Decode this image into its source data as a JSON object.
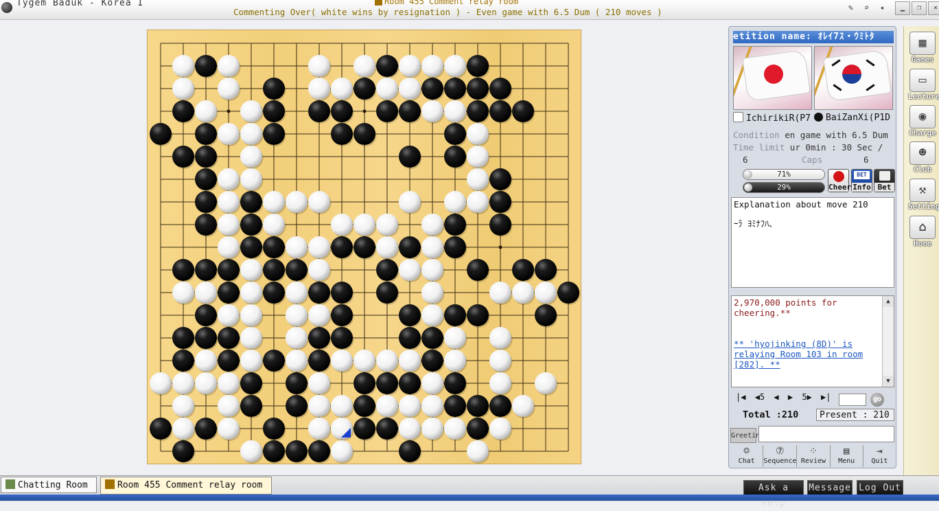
{
  "window": {
    "app_title": "Tygem Baduk - Korea I",
    "room_title": "Room 455 Comment relay room",
    "status_line": "Commenting Over( white wins by resignation ) - Even game with 6.5 Dum  ( 210 moves )"
  },
  "board": {
    "size": 19,
    "black": [
      [
        2,
        1
      ],
      [
        10,
        1
      ],
      [
        14,
        1
      ],
      [
        5,
        2
      ],
      [
        9,
        2
      ],
      [
        12,
        2
      ],
      [
        13,
        2
      ],
      [
        14,
        2
      ],
      [
        15,
        2
      ],
      [
        1,
        3
      ],
      [
        5,
        3
      ],
      [
        7,
        3
      ],
      [
        8,
        3
      ],
      [
        10,
        3
      ],
      [
        11,
        3
      ],
      [
        14,
        3
      ],
      [
        15,
        3
      ],
      [
        16,
        3
      ],
      [
        0,
        4
      ],
      [
        2,
        4
      ],
      [
        5,
        4
      ],
      [
        8,
        4
      ],
      [
        9,
        4
      ],
      [
        13,
        4
      ],
      [
        1,
        5
      ],
      [
        2,
        5
      ],
      [
        11,
        5
      ],
      [
        13,
        5
      ],
      [
        2,
        6
      ],
      [
        15,
        6
      ],
      [
        2,
        7
      ],
      [
        4,
        7
      ],
      [
        15,
        7
      ],
      [
        2,
        8
      ],
      [
        4,
        8
      ],
      [
        13,
        8
      ],
      [
        15,
        8
      ],
      [
        4,
        9
      ],
      [
        5,
        9
      ],
      [
        8,
        9
      ],
      [
        9,
        9
      ],
      [
        11,
        9
      ],
      [
        13,
        9
      ],
      [
        1,
        10
      ],
      [
        2,
        10
      ],
      [
        3,
        10
      ],
      [
        5,
        10
      ],
      [
        6,
        10
      ],
      [
        10,
        10
      ],
      [
        14,
        10
      ],
      [
        16,
        10
      ],
      [
        17,
        10
      ],
      [
        3,
        11
      ],
      [
        5,
        11
      ],
      [
        7,
        11
      ],
      [
        8,
        11
      ],
      [
        10,
        11
      ],
      [
        18,
        11
      ],
      [
        2,
        12
      ],
      [
        8,
        12
      ],
      [
        11,
        12
      ],
      [
        13,
        12
      ],
      [
        14,
        12
      ],
      [
        17,
        12
      ],
      [
        1,
        13
      ],
      [
        2,
        13
      ],
      [
        3,
        13
      ],
      [
        7,
        13
      ],
      [
        8,
        13
      ],
      [
        11,
        13
      ],
      [
        12,
        13
      ],
      [
        1,
        14
      ],
      [
        3,
        14
      ],
      [
        5,
        14
      ],
      [
        7,
        14
      ],
      [
        12,
        14
      ],
      [
        4,
        15
      ],
      [
        6,
        15
      ],
      [
        9,
        15
      ],
      [
        10,
        15
      ],
      [
        11,
        15
      ],
      [
        13,
        15
      ],
      [
        4,
        16
      ],
      [
        6,
        16
      ],
      [
        9,
        16
      ],
      [
        13,
        16
      ],
      [
        14,
        16
      ],
      [
        15,
        16
      ],
      [
        0,
        17
      ],
      [
        2,
        17
      ],
      [
        5,
        17
      ],
      [
        9,
        17
      ],
      [
        10,
        17
      ],
      [
        14,
        17
      ],
      [
        1,
        18
      ],
      [
        5,
        18
      ],
      [
        6,
        18
      ],
      [
        7,
        18
      ],
      [
        11,
        18
      ]
    ],
    "white": [
      [
        1,
        1
      ],
      [
        3,
        1
      ],
      [
        7,
        1
      ],
      [
        9,
        1
      ],
      [
        11,
        1
      ],
      [
        12,
        1
      ],
      [
        13,
        1
      ],
      [
        1,
        2
      ],
      [
        3,
        2
      ],
      [
        7,
        2
      ],
      [
        8,
        2
      ],
      [
        10,
        2
      ],
      [
        11,
        2
      ],
      [
        2,
        3
      ],
      [
        4,
        3
      ],
      [
        12,
        3
      ],
      [
        13,
        3
      ],
      [
        3,
        4
      ],
      [
        4,
        4
      ],
      [
        14,
        4
      ],
      [
        4,
        5
      ],
      [
        14,
        5
      ],
      [
        3,
        6
      ],
      [
        4,
        6
      ],
      [
        14,
        6
      ],
      [
        3,
        7
      ],
      [
        5,
        7
      ],
      [
        6,
        7
      ],
      [
        7,
        7
      ],
      [
        11,
        7
      ],
      [
        13,
        7
      ],
      [
        14,
        7
      ],
      [
        3,
        8
      ],
      [
        5,
        8
      ],
      [
        8,
        8
      ],
      [
        9,
        8
      ],
      [
        10,
        8
      ],
      [
        12,
        8
      ],
      [
        3,
        9
      ],
      [
        6,
        9
      ],
      [
        7,
        9
      ],
      [
        10,
        9
      ],
      [
        12,
        9
      ],
      [
        4,
        10
      ],
      [
        7,
        10
      ],
      [
        11,
        10
      ],
      [
        12,
        10
      ],
      [
        1,
        11
      ],
      [
        2,
        11
      ],
      [
        4,
        11
      ],
      [
        6,
        11
      ],
      [
        12,
        11
      ],
      [
        15,
        11
      ],
      [
        16,
        11
      ],
      [
        17,
        11
      ],
      [
        3,
        12
      ],
      [
        4,
        12
      ],
      [
        6,
        12
      ],
      [
        7,
        12
      ],
      [
        12,
        12
      ],
      [
        4,
        13
      ],
      [
        6,
        13
      ],
      [
        13,
        13
      ],
      [
        15,
        13
      ],
      [
        2,
        14
      ],
      [
        4,
        14
      ],
      [
        6,
        14
      ],
      [
        8,
        14
      ],
      [
        9,
        14
      ],
      [
        10,
        14
      ],
      [
        11,
        14
      ],
      [
        13,
        14
      ],
      [
        15,
        14
      ],
      [
        0,
        15
      ],
      [
        1,
        15
      ],
      [
        2,
        15
      ],
      [
        3,
        15
      ],
      [
        7,
        15
      ],
      [
        12,
        15
      ],
      [
        15,
        15
      ],
      [
        17,
        15
      ],
      [
        1,
        16
      ],
      [
        3,
        16
      ],
      [
        7,
        16
      ],
      [
        8,
        16
      ],
      [
        10,
        16
      ],
      [
        11,
        16
      ],
      [
        12,
        16
      ],
      [
        16,
        16
      ],
      [
        1,
        17
      ],
      [
        3,
        17
      ],
      [
        7,
        17
      ],
      [
        8,
        17
      ],
      [
        11,
        17
      ],
      [
        12,
        17
      ],
      [
        13,
        17
      ],
      [
        15,
        17
      ],
      [
        4,
        18
      ],
      [
        8,
        18
      ],
      [
        14,
        18
      ]
    ],
    "last_move": [
      8,
      17
    ],
    "marker_color": "#1a3fcf"
  },
  "panel": {
    "competition_name": "etition name: ｵﾚｲ7ｽ・ｳﾐﾄﾀ",
    "white_player": "IchirikiR(P7",
    "black_player": "BaiZanXi(P1D",
    "condition_label": "Condition",
    "condition_value": " en game with 6.5 Dum",
    "time_label": "Time limit",
    "time_value": " ur 0min : 30 Sec /",
    "caps_label": "Caps",
    "caps_white": "6",
    "caps_black": "6",
    "white_win_pct": "71%",
    "white_win_fraction": 0.71,
    "black_win_pct": "29%",
    "black_win_fraction": 0.29,
    "cheer_label": "Cheer",
    "info_label": "Info",
    "bet_label": "Bet",
    "bet_badge": "BET",
    "explanation_title": "Explanation about move 210",
    "explanation_text": "ｰﾗ ﾖﾐﾅﾌﾊ､",
    "chat_line1": "2,970,000 points for cheering.**",
    "chat_line2": "** 'hyojinking (8D)' is relaying Room 103 in room [282]. **",
    "nav": {
      "first": "|◀",
      "back5": "◀5",
      "prev": "◀",
      "next": "▶",
      "fwd5": "5▶",
      "last": "▶|",
      "go": "go"
    },
    "total": "Total :210",
    "present": "Present : 210",
    "greeting_label": "Greeting",
    "actions": [
      "Chat",
      "Sequence",
      "Review",
      "Menu",
      "Quit"
    ]
  },
  "rightbar": [
    "Games",
    "Lecture",
    "Charge",
    "Club",
    "Setting",
    "Home"
  ],
  "taskbar": {
    "chat_tab": "Chatting Room",
    "room_tab": "Room 455 Comment relay room",
    "ask_help": "Ask a help",
    "message": "Message",
    "logout": "Log Out"
  },
  "colors": {
    "board": "#f2cf7a",
    "panel": "#d8dce4",
    "title_accent": "#8a7000"
  }
}
